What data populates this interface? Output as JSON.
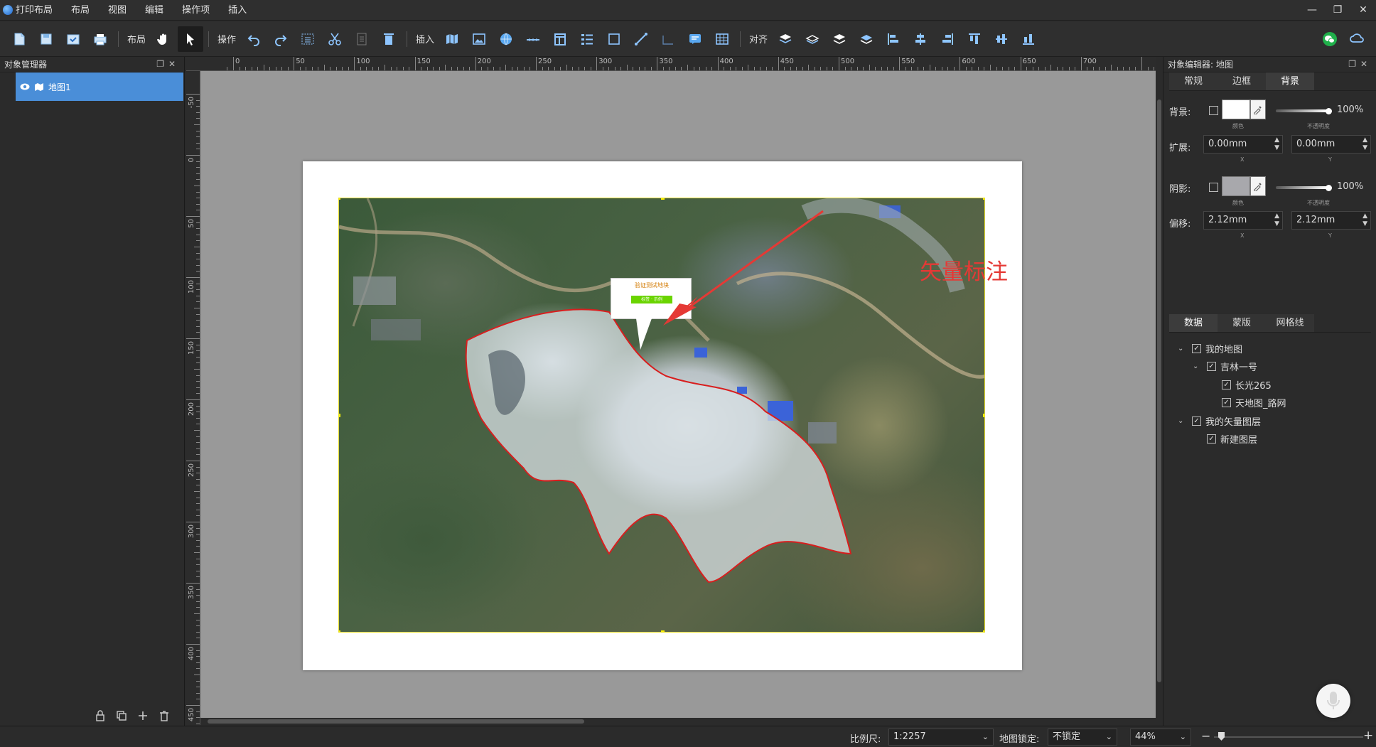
{
  "menubar": {
    "title": "打印布局",
    "items": [
      "布局",
      "视图",
      "编辑",
      "操作项",
      "插入"
    ]
  },
  "toolbar": {
    "groups": {
      "layout": "布局",
      "operate": "操作",
      "insert": "插入",
      "align": "对齐"
    }
  },
  "ruler": {
    "h_labels": [
      "50",
      "0",
      "50",
      "100",
      "150",
      "200",
      "250",
      "300",
      "350",
      "400",
      "450",
      "500",
      "550",
      "600",
      "650",
      "700"
    ],
    "v_labels": [
      "-50",
      "0",
      "50",
      "100",
      "150",
      "200",
      "250",
      "300",
      "350",
      "400",
      "450"
    ]
  },
  "object_manager": {
    "title": "对象管理器",
    "items": [
      {
        "label": "地图1"
      }
    ]
  },
  "map_callout": {
    "title": "验证测试地块",
    "bar": "标签 · 示例"
  },
  "annotation": {
    "text": "矢量标注",
    "color": "#e53935"
  },
  "object_editor": {
    "title": "对象编辑器: 地图",
    "tabs": [
      "常规",
      "边框",
      "背景"
    ],
    "active_tab": "背景",
    "background": {
      "label": "背景:",
      "color_caption": "颜色",
      "opacity_caption": "不透明度",
      "opacity": "100%",
      "swatch_color": "#ffffff"
    },
    "expand": {
      "label": "扩展:",
      "x_value": "0.00mm",
      "y_value": "0.00mm",
      "x_caption": "X",
      "y_caption": "Y"
    },
    "shadow": {
      "label": "阴影:",
      "color_caption": "颜色",
      "opacity_caption": "不透明度",
      "opacity": "100%",
      "swatch_color": "#a8a8ac"
    },
    "offset": {
      "label": "偏移:",
      "x_value": "2.12mm",
      "y_value": "2.12mm",
      "x_caption": "X",
      "y_caption": "Y"
    }
  },
  "data_panel": {
    "tabs": [
      "数据",
      "蒙版",
      "网格线"
    ],
    "active_tab": "数据",
    "tree": [
      {
        "label": "我的地图",
        "level": 0,
        "arrow": true
      },
      {
        "label": "吉林一号",
        "level": 1,
        "arrow": true
      },
      {
        "label": "长光265",
        "level": 2,
        "arrow": false
      },
      {
        "label": "天地图_路网",
        "level": 2,
        "arrow": false
      },
      {
        "label": "我的矢量图层",
        "level": 0,
        "arrow": true
      },
      {
        "label": "新建图层",
        "level": 1,
        "arrow": false
      }
    ]
  },
  "statusbar": {
    "scale_label": "比例尺:",
    "scale_value": "1:2257",
    "lock_label": "地图锁定:",
    "lock_value": "不锁定",
    "zoom_value": "44%"
  },
  "colors": {
    "accent": "#4a8ed8",
    "map_border": "#e6dd2e",
    "boundary": "#d81e1e"
  }
}
